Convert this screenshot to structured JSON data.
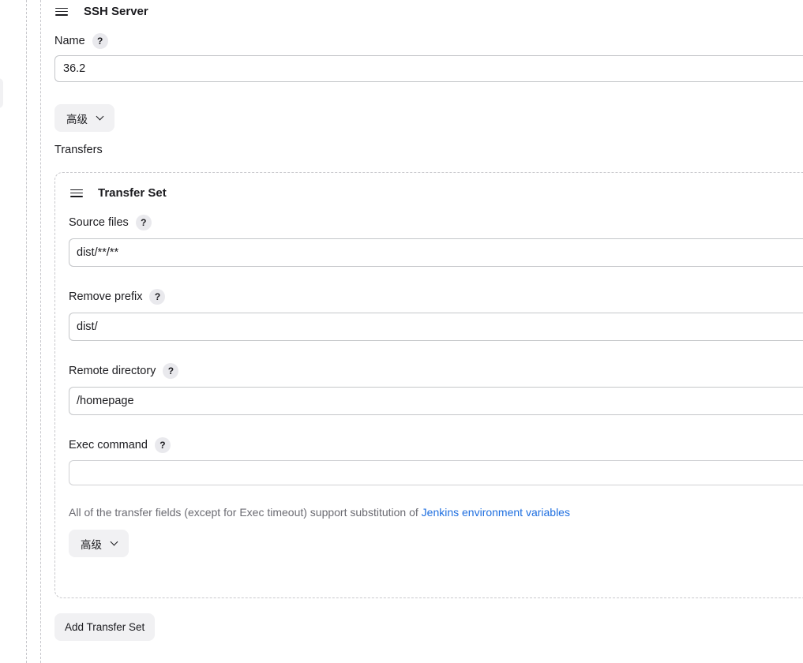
{
  "ssh_server": {
    "title": "SSH Server",
    "name_label": "Name",
    "name_value": "36.2",
    "advanced_label": "高级",
    "transfers_label": "Transfers"
  },
  "transfer_set": {
    "title": "Transfer Set",
    "source_files_label": "Source files",
    "source_files_value": "dist/**/**",
    "remove_prefix_label": "Remove prefix",
    "remove_prefix_value": "dist/",
    "remote_directory_label": "Remote directory",
    "remote_directory_value": "/homepage",
    "exec_command_label": "Exec command",
    "exec_command_value": "",
    "note_text": "All of the transfer fields (except for Exec timeout) support substitution of ",
    "note_link": "Jenkins environment variables",
    "advanced_label": "高级"
  },
  "help_glyph": "?",
  "add_transfer_set_label": "Add Transfer Set",
  "colors": {
    "link": "#1f6fe0",
    "button_bg": "#f1f1f3",
    "help_bg": "#e9e9ed",
    "border": "#c4c6c9"
  }
}
